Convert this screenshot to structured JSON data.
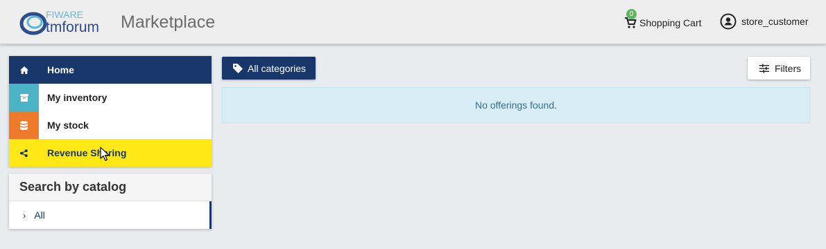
{
  "header": {
    "logo_text_top": "FIWARE",
    "logo_text_bottom": "tmforum",
    "title": "Marketplace",
    "cart_count": "0",
    "cart_label": "Shopping Cart",
    "user_label": "store_customer"
  },
  "nav": {
    "items": [
      {
        "label": "Home",
        "icon": "home-icon"
      },
      {
        "label": "My inventory",
        "icon": "archive-icon"
      },
      {
        "label": "My stock",
        "icon": "database-icon"
      },
      {
        "label": "Revenue Sharing",
        "icon": "share-icon"
      }
    ]
  },
  "catalog": {
    "heading": "Search by catalog",
    "items": [
      {
        "label": "All"
      }
    ]
  },
  "main": {
    "categories_button": "All categories",
    "filters_button": "Filters",
    "empty_message": "No offerings found."
  },
  "colors": {
    "primary": "#17376b",
    "highlight": "#ffe815",
    "inventory": "#4ab3c6",
    "stock": "#f07a2c",
    "badge": "#5cb85c",
    "alert_bg": "#d9edf7"
  }
}
